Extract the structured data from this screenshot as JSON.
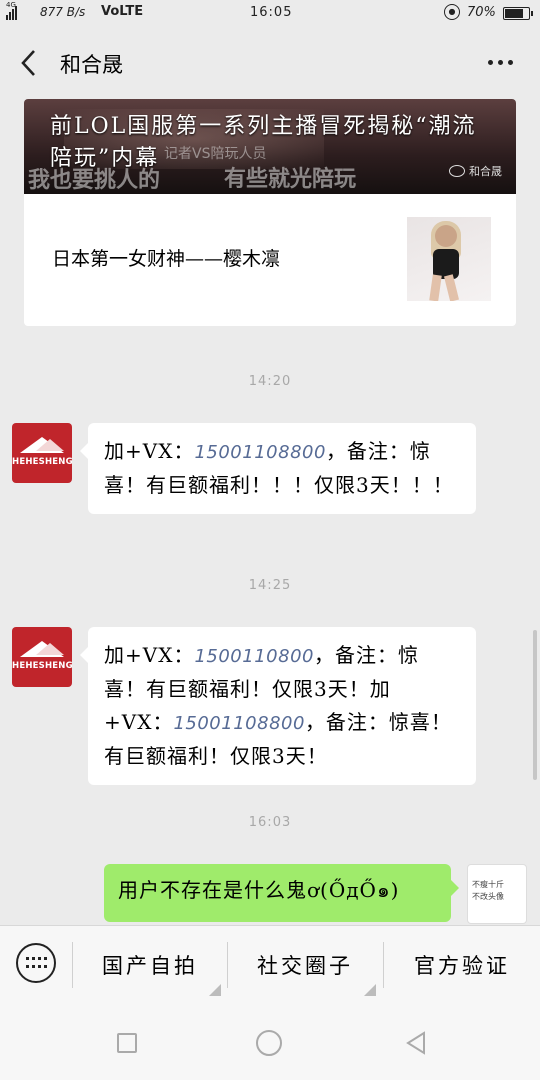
{
  "status_bar": {
    "network_tag": "4G",
    "speed": "877 B/s",
    "volte": "VoLTE",
    "time": "16:05",
    "battery": "70%"
  },
  "header": {
    "title": "和合晟"
  },
  "article": {
    "headline": "前LOL国服第一系列主播冒死揭秘“潮流陪玩”内幕",
    "cover_overlay_top": "记者VS陪玩人员",
    "cover_overlay_left": "我也要挑人的",
    "cover_overlay_right": "有些就光陪玩",
    "watermark": "和合晟",
    "sub_title": "日本第一女财神——樱木凛"
  },
  "messages": [
    {
      "timestamp": "14:20",
      "avatar_label": "HEHESHENG",
      "prefix": "加+VX：",
      "phone": "15001108800",
      "text": "，备注：惊喜！有巨额福利！！！仅限3天！！！"
    },
    {
      "timestamp": "14:25",
      "avatar_label": "HEHESHENG",
      "prefix": "加+VX：",
      "phone": "1500110800",
      "text": "，备注：惊喜！有巨额福利！仅限3天！加+VX：",
      "phone2": "15001108800",
      "text2": "，备注：惊喜！有巨额福利！仅限3天！"
    },
    {
      "timestamp": "16:03",
      "text": "用户不存在是什么鬼ơ(ŐдŐ๑)",
      "my_avatar_text_1": "不瘦十斤",
      "my_avatar_text_2": "不改头像"
    }
  ],
  "menu": {
    "items": [
      "国产自拍",
      "社交圈子",
      "官方验证"
    ]
  },
  "colors": {
    "background": "#ebebeb",
    "link": "#576b95",
    "sent_bubble": "#9feb6b",
    "brand_avatar": "#c0252b"
  }
}
